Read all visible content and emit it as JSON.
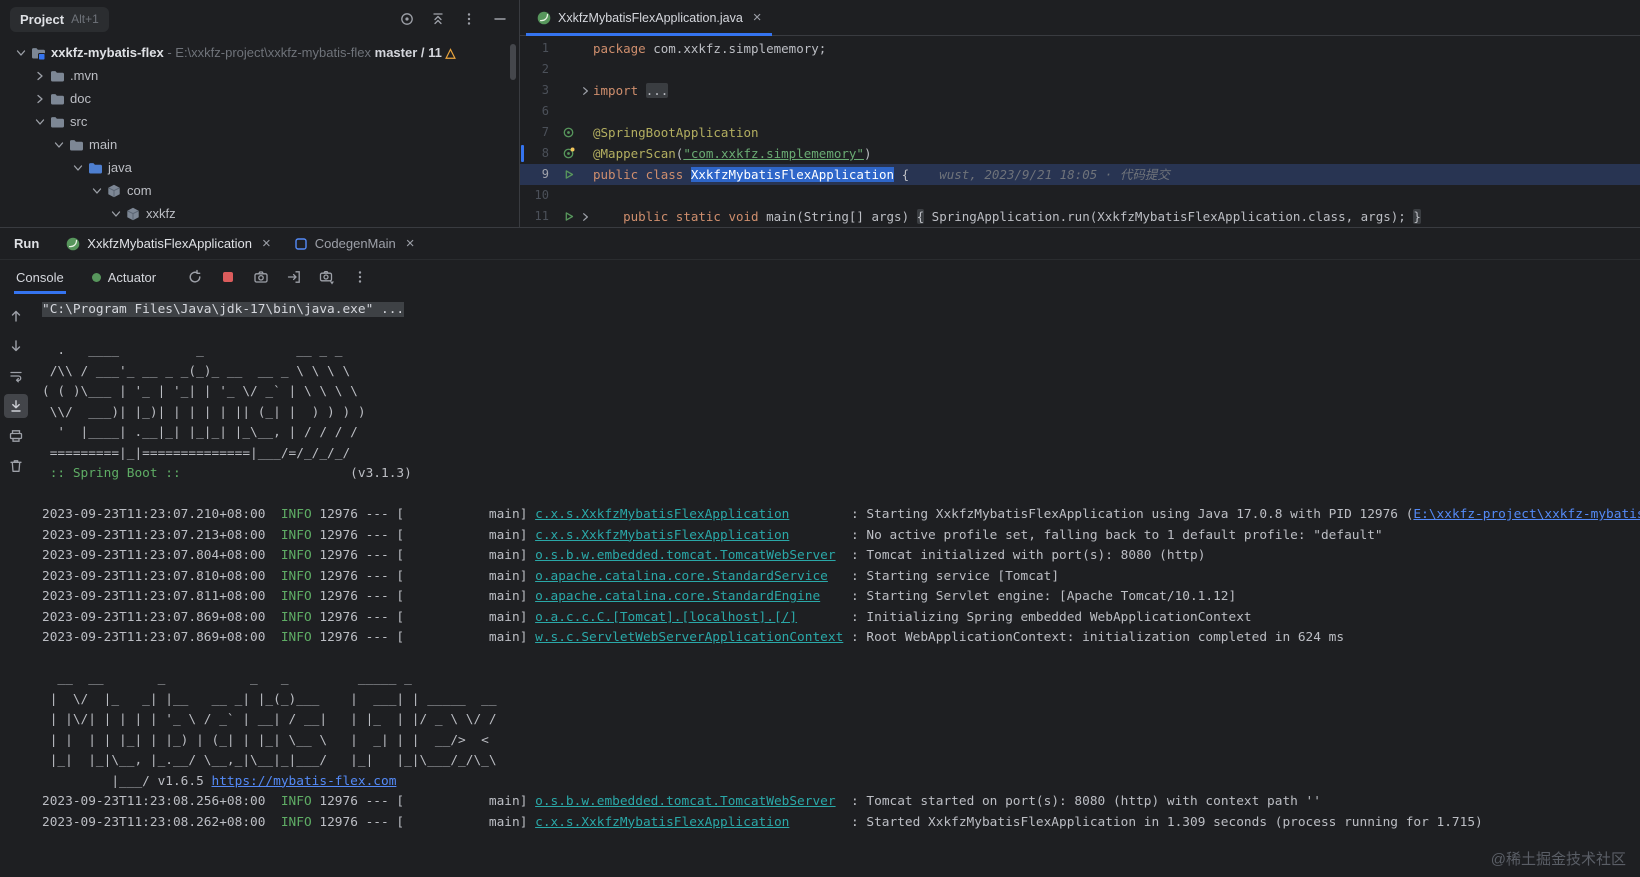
{
  "colors": {
    "accent": "#3574F0",
    "selection-blue": "#2E66C9",
    "keyword-orange": "#CF8E6D",
    "annotation-yellow": "#B3AE60",
    "string-green": "#6AAB73",
    "info-green": "#5FAD65",
    "logger-teal": "#2AA8A8",
    "link-blue": "#548AF7",
    "run-green": "#57965C",
    "stop-red": "#DB5C5C",
    "warn-yellow": "#F2C55C"
  },
  "project_panel": {
    "title": "Project",
    "shortcut": "Alt+1",
    "tree": [
      {
        "depth": 0,
        "chevron": "down",
        "icon": "project",
        "segments": [
          {
            "t": "xxkfz-mybatis-flex",
            "c": "rootname"
          },
          {
            "t": " - E:\\xxkfz-project\\xxkfz-mybatis-flex ",
            "c": "path"
          },
          {
            "t": "master / 11 ",
            "c": "branch"
          },
          {
            "t": "△",
            "c": "delta"
          }
        ]
      },
      {
        "depth": 1,
        "chevron": "right",
        "icon": "folder",
        "segments": [
          {
            "t": ".mvn",
            "c": "name"
          }
        ]
      },
      {
        "depth": 1,
        "chevron": "right",
        "icon": "folder",
        "segments": [
          {
            "t": "doc",
            "c": "name"
          }
        ]
      },
      {
        "depth": 1,
        "chevron": "down",
        "icon": "folder",
        "segments": [
          {
            "t": "src",
            "c": "name"
          }
        ]
      },
      {
        "depth": 2,
        "chevron": "down",
        "icon": "folder",
        "segments": [
          {
            "t": "main",
            "c": "name"
          }
        ]
      },
      {
        "depth": 3,
        "chevron": "down",
        "icon": "folder-src",
        "segments": [
          {
            "t": "java",
            "c": "name"
          }
        ]
      },
      {
        "depth": 4,
        "chevron": "down",
        "icon": "package",
        "segments": [
          {
            "t": "com",
            "c": "name"
          }
        ]
      },
      {
        "depth": 5,
        "chevron": "down",
        "icon": "package",
        "segments": [
          {
            "t": "xxkfz",
            "c": "name"
          }
        ]
      }
    ]
  },
  "editor": {
    "tab_label": "XxkfzMybatisFlexApplication.java",
    "lines": [
      {
        "num": "1",
        "segs": [
          {
            "t": "package ",
            "c": "kw"
          },
          {
            "t": "com.xxkfz.simplememory;",
            "c": "fg"
          }
        ]
      },
      {
        "num": "2",
        "segs": []
      },
      {
        "num": "3",
        "fold": true,
        "segs": [
          {
            "t": "import ",
            "c": "kw"
          },
          {
            "t": "...",
            "c": "folded"
          }
        ]
      },
      {
        "num": "6",
        "segs": []
      },
      {
        "num": "7",
        "gicon": "bean",
        "segs": [
          {
            "t": "@SpringBootApplication",
            "c": "ann"
          }
        ]
      },
      {
        "num": "8",
        "gicon": "bean-warn",
        "change": true,
        "segs": [
          {
            "t": "@MapperScan",
            "c": "ann"
          },
          {
            "t": "(",
            "c": "fg"
          },
          {
            "t": "\"com.xxkfz.simplememory\"",
            "c": "stru"
          },
          {
            "t": ")",
            "c": "fg"
          }
        ]
      },
      {
        "num": "9",
        "gicon": "run",
        "current": true,
        "segs": [
          {
            "t": "public class ",
            "c": "kw"
          },
          {
            "t": "XxkfzMybatisFlexApplication",
            "c": "selid"
          },
          {
            "t": " {",
            "c": "fg"
          },
          {
            "t": "    wust, 2023/9/21 18:05 · 代码提交",
            "c": "inlay"
          }
        ]
      },
      {
        "num": "10",
        "segs": []
      },
      {
        "num": "11",
        "gicon": "run",
        "fold": true,
        "segs": [
          {
            "t": "    ",
            "c": "fg"
          },
          {
            "t": "public static void ",
            "c": "kw"
          },
          {
            "t": "main(String[] args) ",
            "c": "fg"
          },
          {
            "t": "{",
            "c": "folded"
          },
          {
            "t": " SpringApplication.run(XxkfzMybatisFlexApplication.class, args); ",
            "c": "fg"
          },
          {
            "t": "}",
            "c": "folded"
          }
        ]
      }
    ]
  },
  "run_panel": {
    "label": "Run",
    "tabs": [
      {
        "label": "XxkfzMybatisFlexApplication",
        "icon": "spring",
        "selected": true
      },
      {
        "label": "CodegenMain",
        "icon": "class",
        "selected": false
      }
    ],
    "views": {
      "console": "Console",
      "actuator": "Actuator"
    }
  },
  "console": {
    "lines": [
      {
        "segs": [
          {
            "t": "\"C:\\Program Files\\Java\\jdk-17\\bin\\java.exe\" ...",
            "c": "sel"
          }
        ]
      },
      {
        "segs": []
      },
      {
        "segs": [
          {
            "t": "  .   ____          _            __ _ _",
            "c": "fg"
          }
        ]
      },
      {
        "segs": [
          {
            "t": " /\\\\ / ___'_ __ _ _(_)_ __  __ _ \\ \\ \\ \\",
            "c": "fg"
          }
        ]
      },
      {
        "segs": [
          {
            "t": "( ( )\\___ | '_ | '_| | '_ \\/ _` | \\ \\ \\ \\",
            "c": "fg"
          }
        ]
      },
      {
        "segs": [
          {
            "t": " \\\\/  ___)| |_)| | | | | || (_| |  ) ) ) )",
            "c": "fg"
          }
        ]
      },
      {
        "segs": [
          {
            "t": "  '  |____| .__|_| |_|_| |_\\__, | / / / /",
            "c": "fg"
          }
        ]
      },
      {
        "segs": [
          {
            "t": " =========|_|==============|___/=/_/_/_/",
            "c": "fg"
          }
        ]
      },
      {
        "segs": [
          {
            "t": " :: Spring Boot ::",
            "c": "green"
          },
          {
            "t": "                      (v3.1.3)",
            "c": "fg"
          }
        ]
      },
      {
        "segs": []
      },
      {
        "segs": [
          {
            "t": "2023-09-23T11:23:07.210+08:00 ",
            "c": "fg"
          },
          {
            "t": " INFO",
            "c": "green"
          },
          {
            "t": " 12976 --- [           main] ",
            "c": "fg"
          },
          {
            "t": "c.x.s.XxkfzMybatisFlexApplication",
            "c": "logger"
          },
          {
            "t": "        : Starting XxkfzMybatisFlexApplication using Java 17.0.8 with PID 12976 (",
            "c": "fg"
          },
          {
            "t": "E:\\xxkfz-project\\xxkfz-mybatis-flex",
            "c": "link"
          }
        ]
      },
      {
        "segs": [
          {
            "t": "2023-09-23T11:23:07.213+08:00 ",
            "c": "fg"
          },
          {
            "t": " INFO",
            "c": "green"
          },
          {
            "t": " 12976 --- [           main] ",
            "c": "fg"
          },
          {
            "t": "c.x.s.XxkfzMybatisFlexApplication",
            "c": "logger"
          },
          {
            "t": "        : No active profile set, falling back to 1 default profile: \"default\"",
            "c": "fg"
          }
        ]
      },
      {
        "segs": [
          {
            "t": "2023-09-23T11:23:07.804+08:00 ",
            "c": "fg"
          },
          {
            "t": " INFO",
            "c": "green"
          },
          {
            "t": " 12976 --- [           main] ",
            "c": "fg"
          },
          {
            "t": "o.s.b.w.embedded.tomcat.TomcatWebServer",
            "c": "logger"
          },
          {
            "t": "  : Tomcat initialized with port(s): 8080 (http)",
            "c": "fg"
          }
        ]
      },
      {
        "segs": [
          {
            "t": "2023-09-23T11:23:07.810+08:00 ",
            "c": "fg"
          },
          {
            "t": " INFO",
            "c": "green"
          },
          {
            "t": " 12976 --- [           main] ",
            "c": "fg"
          },
          {
            "t": "o.apache.catalina.core.StandardService",
            "c": "logger"
          },
          {
            "t": "   : Starting service [Tomcat]",
            "c": "fg"
          }
        ]
      },
      {
        "segs": [
          {
            "t": "2023-09-23T11:23:07.811+08:00 ",
            "c": "fg"
          },
          {
            "t": " INFO",
            "c": "green"
          },
          {
            "t": " 12976 --- [           main] ",
            "c": "fg"
          },
          {
            "t": "o.apache.catalina.core.StandardEngine",
            "c": "logger"
          },
          {
            "t": "    : Starting Servlet engine: [Apache Tomcat/10.1.12]",
            "c": "fg"
          }
        ]
      },
      {
        "segs": [
          {
            "t": "2023-09-23T11:23:07.869+08:00 ",
            "c": "fg"
          },
          {
            "t": " INFO",
            "c": "green"
          },
          {
            "t": " 12976 --- [           main] ",
            "c": "fg"
          },
          {
            "t": "o.a.c.c.C.[Tomcat].[localhost].[/]",
            "c": "logger"
          },
          {
            "t": "       : Initializing Spring embedded WebApplicationContext",
            "c": "fg"
          }
        ]
      },
      {
        "segs": [
          {
            "t": "2023-09-23T11:23:07.869+08:00 ",
            "c": "fg"
          },
          {
            "t": " INFO",
            "c": "green"
          },
          {
            "t": " 12976 --- [           main] ",
            "c": "fg"
          },
          {
            "t": "w.s.c.ServletWebServerApplicationContext",
            "c": "logger"
          },
          {
            "t": " : Root WebApplicationContext: initialization completed in 624 ms",
            "c": "fg"
          }
        ]
      },
      {
        "segs": []
      },
      {
        "segs": [
          {
            "t": "  __  __       _           _   _         _____ _",
            "c": "fg"
          }
        ]
      },
      {
        "segs": [
          {
            "t": " |  \\/  |_   _| |__   __ _| |_(_)___    |  ___| | _____  __",
            "c": "fg"
          }
        ]
      },
      {
        "segs": [
          {
            "t": " | |\\/| | | | | '_ \\ / _` | __| / __|   | |_  | |/ _ \\ \\/ /",
            "c": "fg"
          }
        ]
      },
      {
        "segs": [
          {
            "t": " | |  | | |_| | |_) | (_| | |_| \\__ \\   |  _| | |  __/>  <",
            "c": "fg"
          }
        ]
      },
      {
        "segs": [
          {
            "t": " |_|  |_|\\__, |_.__/ \\__,_|\\__|_|___/   |_|   |_|\\___/_/\\_\\",
            "c": "fg"
          }
        ]
      },
      {
        "segs": [
          {
            "t": "         |___/ v1.6.5 ",
            "c": "fg"
          },
          {
            "t": "https://mybatis-flex.com",
            "c": "link"
          }
        ]
      },
      {
        "segs": [
          {
            "t": "2023-09-23T11:23:08.256+08:00 ",
            "c": "fg"
          },
          {
            "t": " INFO",
            "c": "green"
          },
          {
            "t": " 12976 --- [           main] ",
            "c": "fg"
          },
          {
            "t": "o.s.b.w.embedded.tomcat.TomcatWebServer",
            "c": "logger"
          },
          {
            "t": "  : Tomcat started on port(s): 8080 (http) with context path ''",
            "c": "fg"
          }
        ]
      },
      {
        "segs": [
          {
            "t": "2023-09-23T11:23:08.262+08:00 ",
            "c": "fg"
          },
          {
            "t": " INFO",
            "c": "green"
          },
          {
            "t": " 12976 --- [           main] ",
            "c": "fg"
          },
          {
            "t": "c.x.s.XxkfzMybatisFlexApplication",
            "c": "logger"
          },
          {
            "t": "        : Started XxkfzMybatisFlexApplication in 1.309 seconds (process running for 1.715)",
            "c": "fg"
          }
        ]
      }
    ]
  },
  "watermark": "@稀土掘金技术社区"
}
